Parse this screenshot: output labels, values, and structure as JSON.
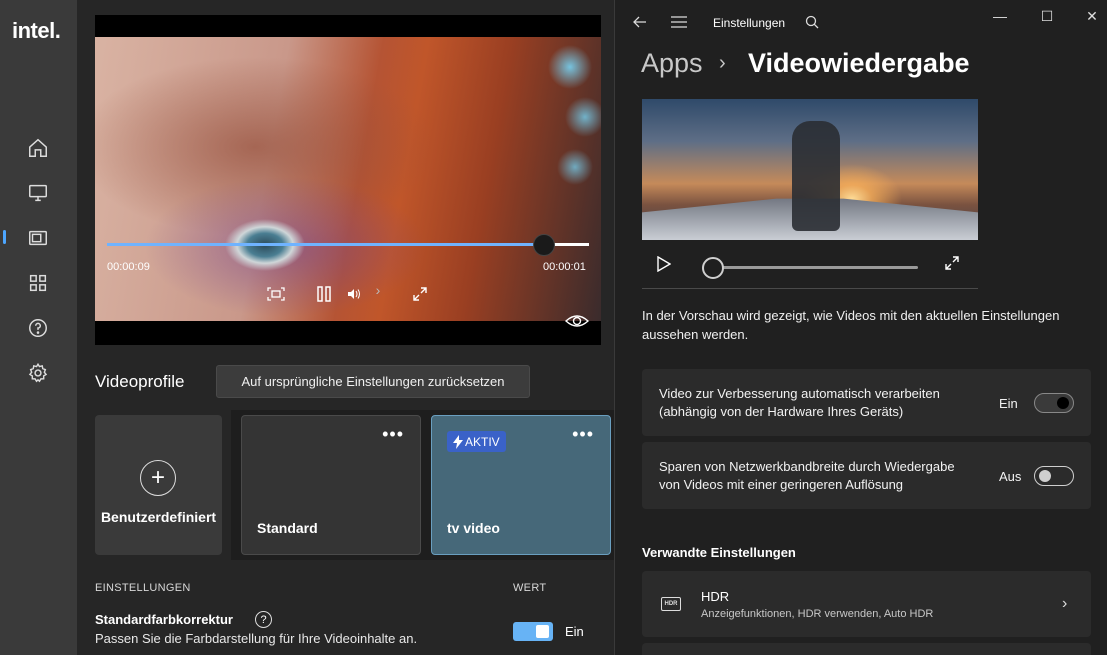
{
  "intel": {
    "logo": "intel.",
    "nav": [
      {
        "name": "home-icon"
      },
      {
        "name": "display-icon"
      },
      {
        "name": "video-icon"
      },
      {
        "name": "apps-icon"
      },
      {
        "name": "help-icon"
      },
      {
        "name": "settings-gear-icon"
      }
    ],
    "player": {
      "time_current": "00:00:09",
      "time_remaining": "00:00:01",
      "progress": 0.9
    },
    "profiles": {
      "title": "Videoprofile",
      "reset_label": "Auf ursprüngliche Einstellungen zurücksetzen",
      "cards": [
        {
          "name": "Benutzerdefiniert"
        },
        {
          "name": "Standard",
          "more": "•••"
        },
        {
          "name": "tv video",
          "more": "•••",
          "badge": "AKTIV"
        }
      ]
    },
    "settings_table": {
      "col_setting": "EINSTELLUNGEN",
      "col_value": "WERT",
      "color_correction": {
        "title": "Standardfarbkorrektur",
        "description": "Passen Sie die Farbdarstellung für Ihre Videoinhalte an.",
        "value": "Ein",
        "enabled": true
      }
    },
    "colors": {
      "accent": "#4da6ff",
      "active_card": "#466879",
      "badge": "#3a62c8"
    }
  },
  "windows_settings": {
    "title": "Einstellungen",
    "breadcrumb": {
      "parent": "Apps",
      "separator": "›",
      "current": "Videowiedergabe"
    },
    "preview_caption": "In der Vorschau wird gezeigt, wie Videos mit den aktuellen Einstellungen aussehen werden.",
    "rows": [
      {
        "text_line1": "Video zur Verbesserung automatisch verarbeiten",
        "text_line2": "(abhängig von der Hardware Ihres Geräts)",
        "state": "Ein",
        "on": true
      },
      {
        "text_line1": "Sparen von Netzwerkbandbreite durch Wiedergabe",
        "text_line2": "von Videos mit einer geringeren Auflösung",
        "state": "Aus",
        "on": false
      }
    ],
    "related_title": "Verwandte Einstellungen",
    "hdr": {
      "icon_text": "HDR",
      "title": "HDR",
      "subtitle": "Anzeigefunktionen, HDR verwenden, Auto HDR"
    },
    "window_controls": {
      "minimize": "—",
      "maximize": "☐",
      "close": "✕"
    }
  }
}
